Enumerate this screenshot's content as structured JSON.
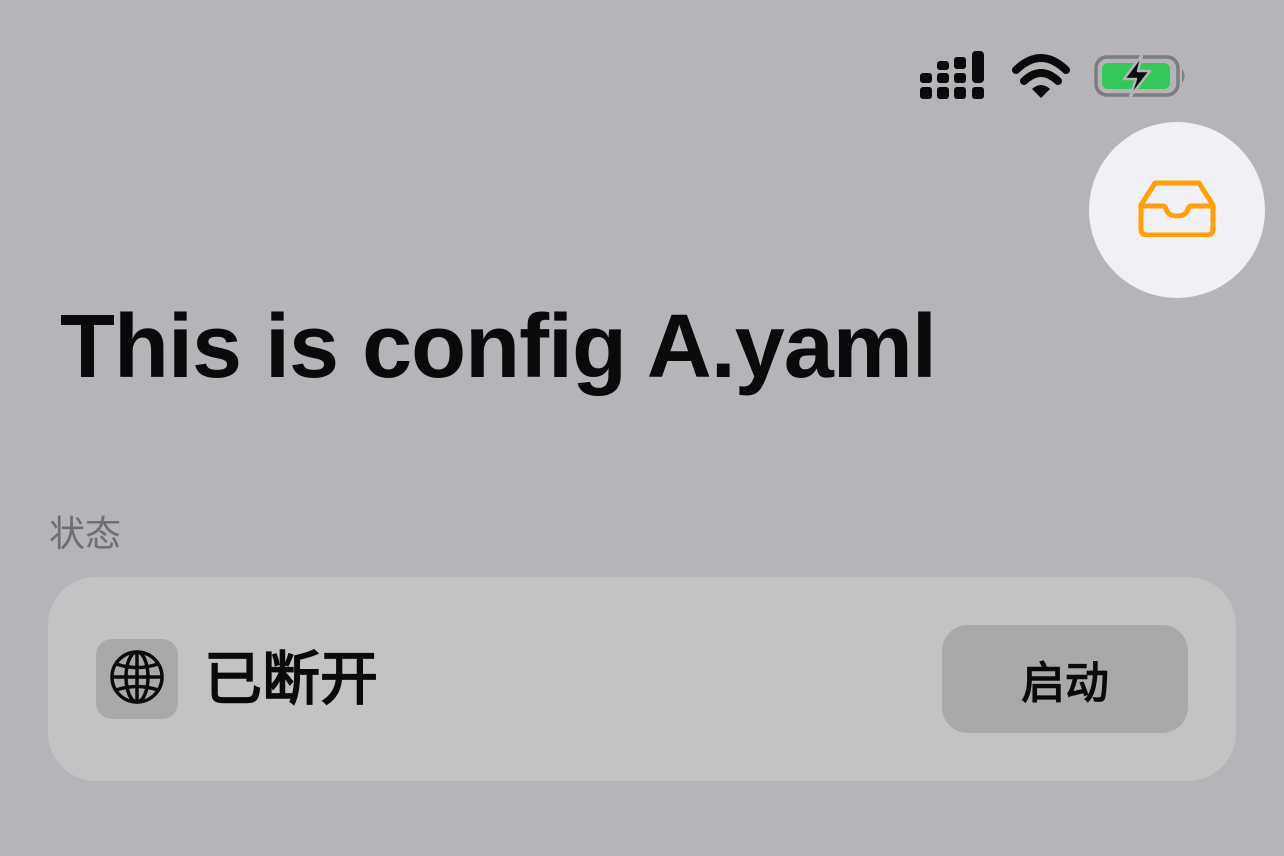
{
  "status_bar": {
    "signal_icon": "cellular-signal-icon",
    "wifi_icon": "wifi-icon",
    "battery_icon": "battery-charging-icon",
    "battery_color": "#35c759"
  },
  "header": {
    "inbox_icon": "tray-icon",
    "accent_color": "#ff9f0a"
  },
  "title": "This is config A.yaml",
  "status_section": {
    "header": "状态",
    "icon": "globe-icon",
    "state_label": "已断开",
    "action_label": "启动"
  }
}
